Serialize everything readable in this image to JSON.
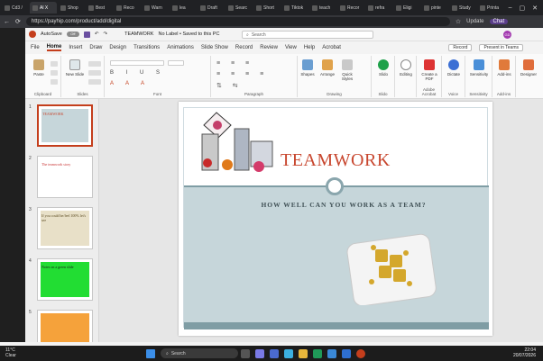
{
  "browser": {
    "tabs": [
      {
        "label": "Cd3 /"
      },
      {
        "label": "Al X",
        "active": true
      },
      {
        "label": "Shop"
      },
      {
        "label": "Best"
      },
      {
        "label": "Reco"
      },
      {
        "label": "Warn"
      },
      {
        "label": "lea"
      },
      {
        "label": "Draft"
      },
      {
        "label": "Searc"
      },
      {
        "label": "Short"
      },
      {
        "label": "Tiktok"
      },
      {
        "label": "teach"
      },
      {
        "label": "Recor"
      },
      {
        "label": "refra"
      },
      {
        "label": "Eligi"
      },
      {
        "label": "pinte"
      },
      {
        "label": "Study"
      },
      {
        "label": "Printa"
      }
    ],
    "url": "https://payhip.com/product/add/digital",
    "update_label": "Update",
    "chat_label": "Chat"
  },
  "ppt": {
    "autosave_label": "AutoSave",
    "autosave_state": "Off",
    "doc_title": "TEAMWORK",
    "label_status": "No Label • Saved to this PC",
    "search_placeholder": "Search",
    "avatar_initials": "GD",
    "menu": [
      "File",
      "Home",
      "Insert",
      "Draw",
      "Design",
      "Transitions",
      "Animations",
      "Slide Show",
      "Record",
      "Review",
      "View",
      "Help",
      "Acrobat"
    ],
    "active_menu": "Home",
    "record_btn": "Record",
    "present_btn": "Present in Teams",
    "ribbon": {
      "paste": "Paste",
      "new_slide": "New Slide",
      "groups": [
        "Clipboard",
        "Slides",
        "Font",
        "Paragraph",
        "Drawing",
        "Slido",
        "Adobe Acrobat",
        "Voice",
        "Sensitivity",
        "Add-ins"
      ],
      "shapes": "Shapes",
      "arrange": "Arrange",
      "quick_styles": "Quick Styles",
      "slido": "Slido",
      "editing": "Editing",
      "create_pdf": "Create a PDF",
      "dictate": "Dictate",
      "sensitivity": "Sensitivity",
      "addins": "Add-ins",
      "designer": "Designer"
    },
    "thumbnails": [
      {
        "num": "1",
        "text": "TEAMWORK"
      },
      {
        "num": "2",
        "text": "The teamwork story"
      },
      {
        "num": "3",
        "text": "If you could be/feel 100% let's see"
      },
      {
        "num": "4",
        "text": "Notes on a green slide"
      },
      {
        "num": "5",
        "text": ""
      }
    ],
    "slide": {
      "title": "TEAMWORK",
      "subtitle": "HOW WELL CAN YOU WORK AS A TEAM?"
    }
  },
  "taskbar": {
    "weather_temp": "11°C",
    "weather_desc": "Clear",
    "search": "Search",
    "time": "22:04",
    "date": "20/07/2026"
  },
  "colors": {
    "accent": "#c43e1c",
    "title_red": "#c8472f",
    "band": "#c6d6da"
  }
}
